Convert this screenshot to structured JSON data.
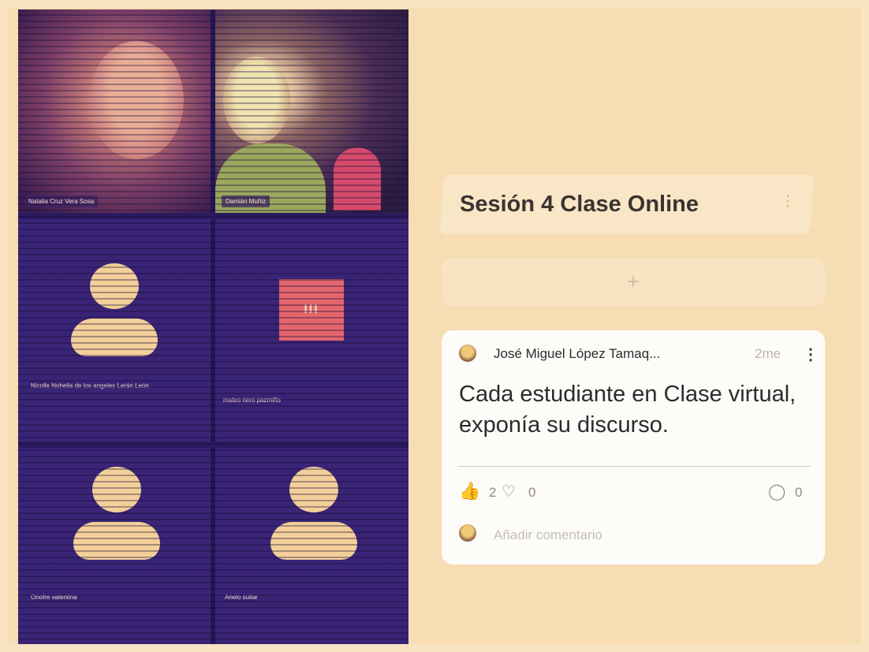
{
  "video_grid": {
    "tiles": [
      {
        "name_label": "Natalia Cruz Vera Sosa"
      },
      {
        "name_label": "Damián Muñiz"
      },
      {
        "name_label": "Nicolle Nohelia de los angeles Lerán León"
      },
      {
        "name_label": "mateo nero pazmiño"
      },
      {
        "name_label": "Onofre valentina"
      },
      {
        "name_label": "Anelo suliar"
      }
    ],
    "calendar_text": "III"
  },
  "section": {
    "title": "Sesión 4 Clase Online"
  },
  "add_post": {
    "plus": "+"
  },
  "post": {
    "author": "José Miguel López Tamaq...",
    "time": "2me",
    "body": "Cada estudiante en Clase virtual, exponía su discurso.",
    "likes": "2",
    "dislikes": "0",
    "comments": "0",
    "comment_placeholder": "Añadir comentario"
  },
  "colors": {
    "page_background": "#f6ddb4",
    "grid_background": "#3a2475",
    "avatar_color": "#f3cf99",
    "like_icon": "#7d63c9"
  }
}
